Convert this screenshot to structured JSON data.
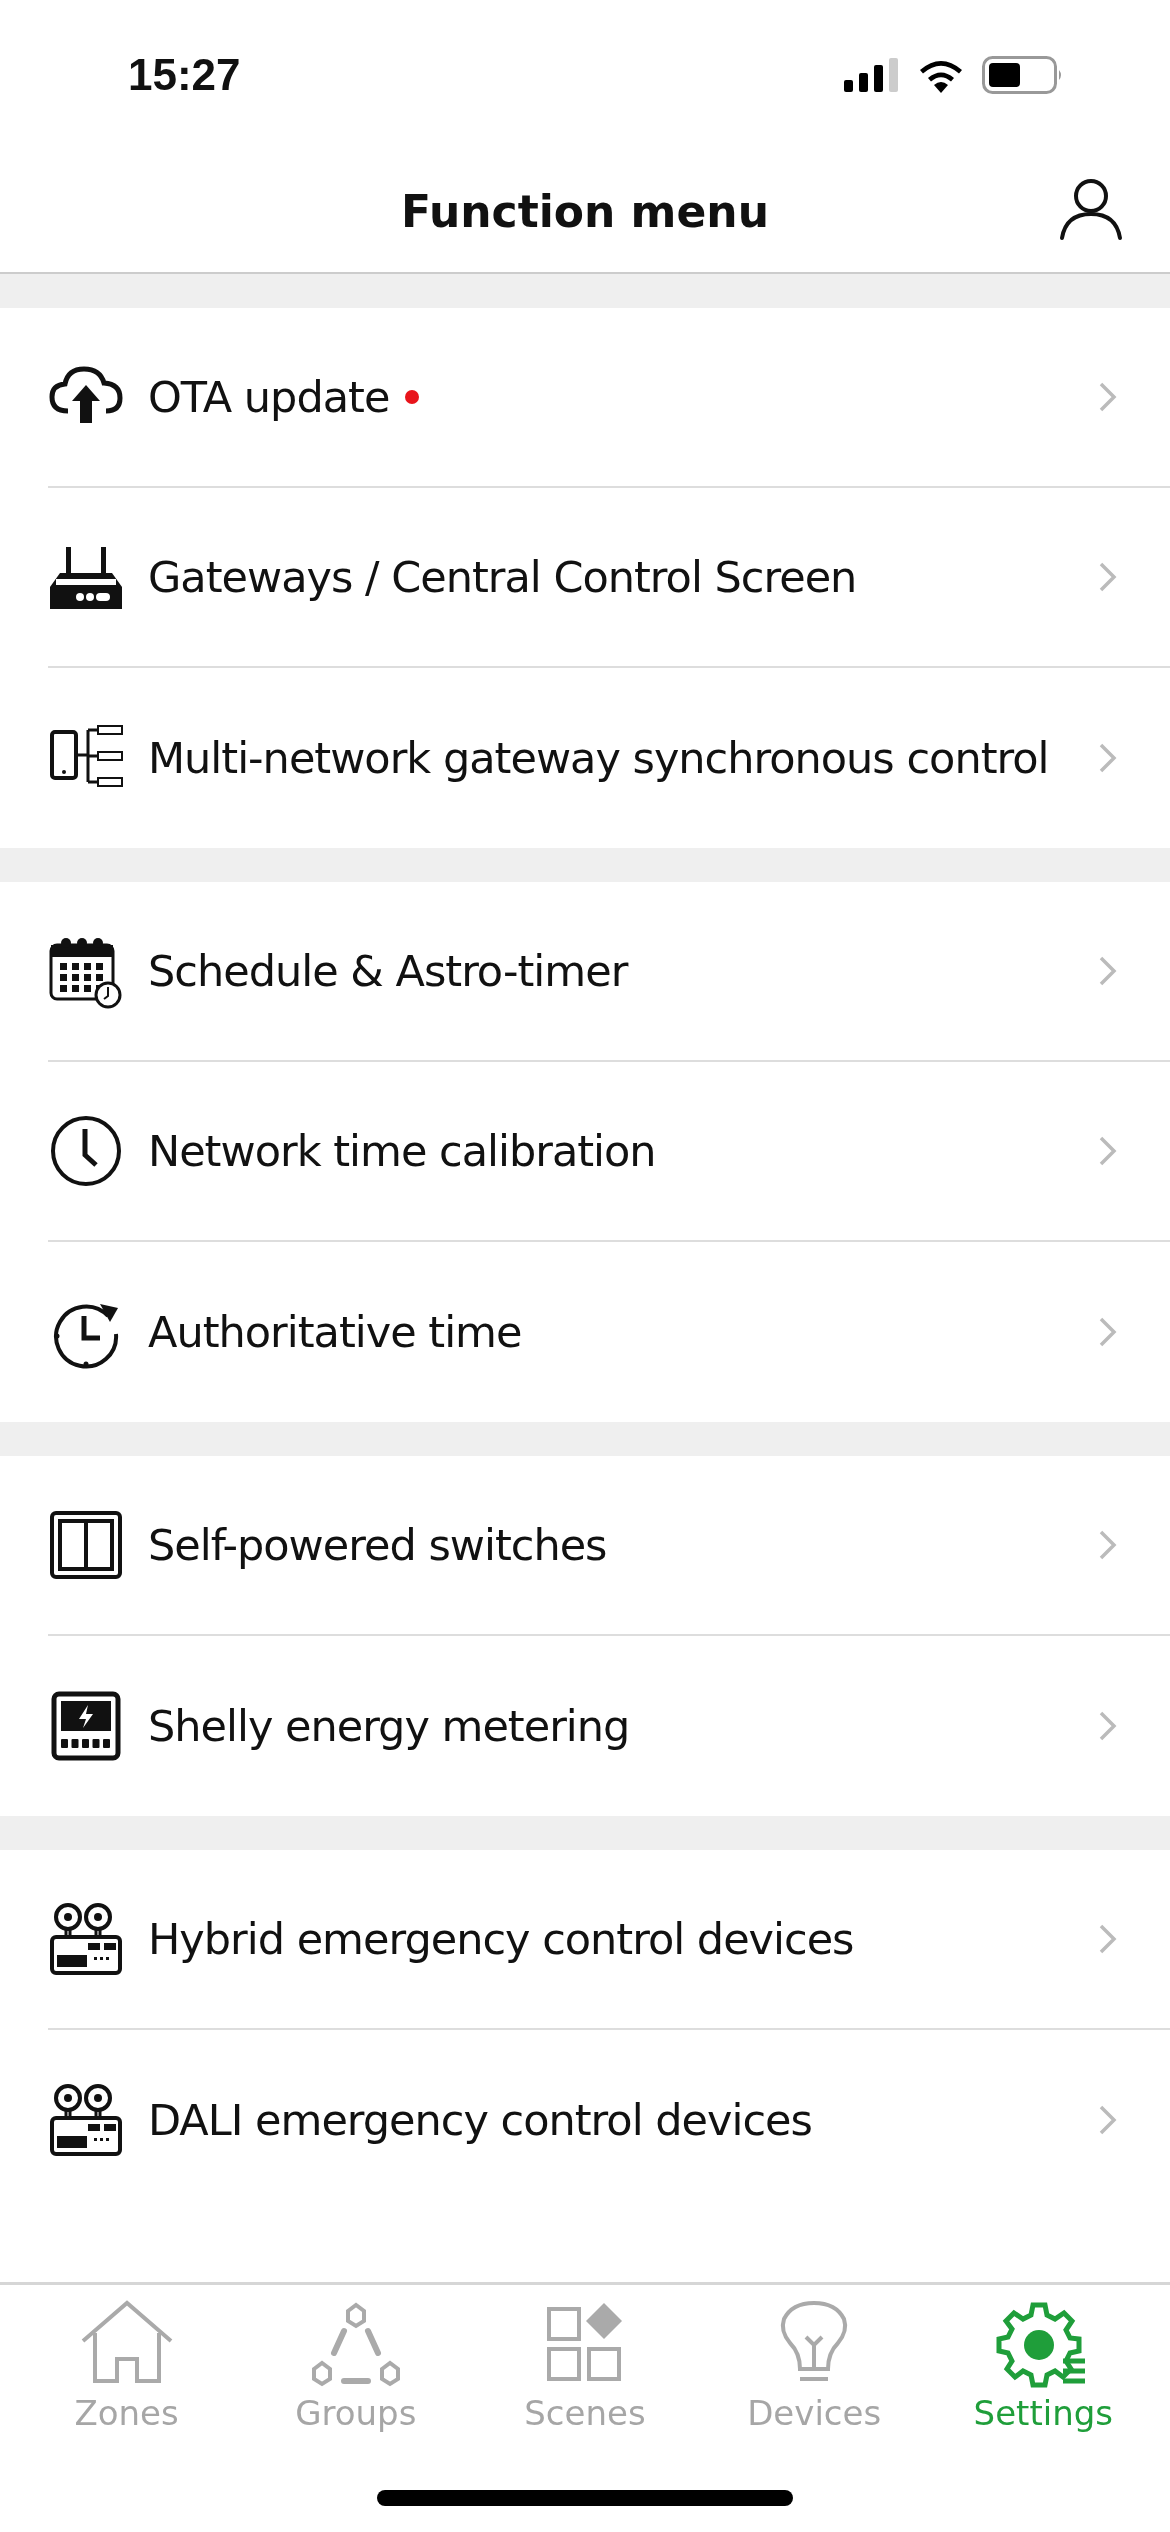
{
  "status_bar": {
    "time": "15:27"
  },
  "header": {
    "title": "Function menu"
  },
  "sections": [
    [
      {
        "kind": "cloud-upload",
        "label": "OTA update",
        "badge": true
      },
      {
        "kind": "router",
        "label": "Gateways / Central Control Screen",
        "badge": false
      },
      {
        "kind": "phone-network",
        "label": "Multi-network gateway synchronous control",
        "badge": false
      }
    ],
    [
      {
        "kind": "calendar",
        "label": "Schedule & Astro-timer",
        "badge": false
      },
      {
        "kind": "clock",
        "label": "Network time calibration",
        "badge": false
      },
      {
        "kind": "clock-refresh",
        "label": "Authoritative time",
        "badge": false
      }
    ],
    [
      {
        "kind": "switch",
        "label": "Self-powered switches",
        "badge": false
      },
      {
        "kind": "meter",
        "label": "Shelly energy metering",
        "badge": false
      }
    ],
    [
      {
        "kind": "emergency",
        "label": "Hybrid emergency control devices",
        "badge": false
      },
      {
        "kind": "emergency",
        "label": "DALI emergency control devices",
        "badge": false
      }
    ]
  ],
  "tabs": [
    {
      "kind": "home",
      "label": "Zones",
      "selected": false
    },
    {
      "kind": "groups",
      "label": "Groups",
      "selected": false
    },
    {
      "kind": "scenes",
      "label": "Scenes",
      "selected": false
    },
    {
      "kind": "bulb",
      "label": "Devices",
      "selected": false
    },
    {
      "kind": "gear",
      "label": "Settings",
      "selected": true
    }
  ]
}
